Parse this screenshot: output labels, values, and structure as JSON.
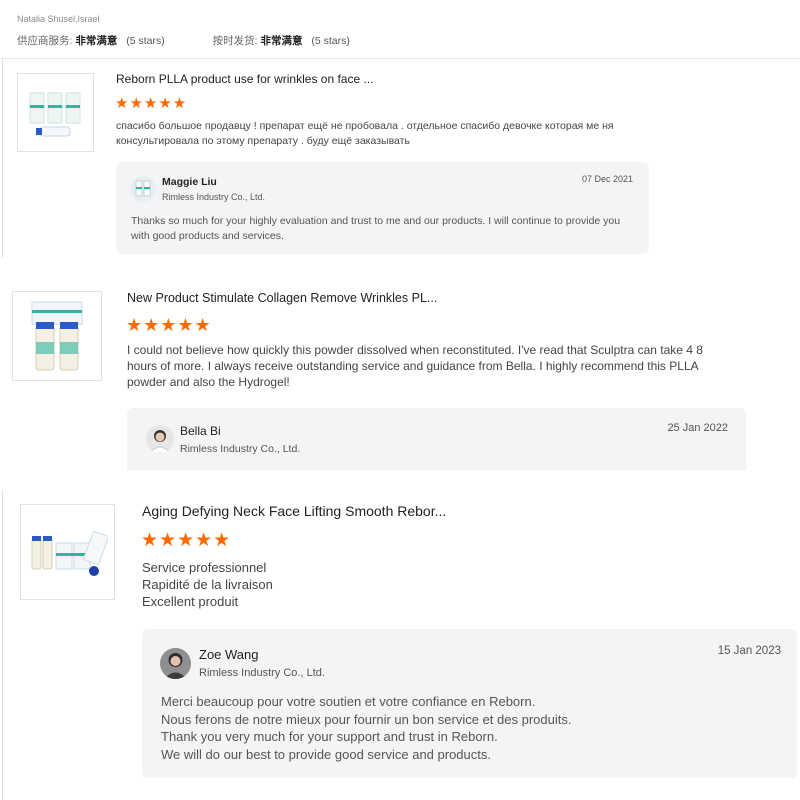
{
  "reviewer": "Natalia Shusel,Israel",
  "ratings": {
    "supplier_label": "供应商服务:",
    "supplier_value": "非常满意",
    "supplier_stars": "(5 stars)",
    "delivery_label": "按时发货:",
    "delivery_value": "非常满意",
    "delivery_stars": "(5 stars)"
  },
  "reviews": [
    {
      "product_title": "Reborn PLLA product use for wrinkles on face ...",
      "stars": "★★★★★",
      "text": "спасибо большое продавцу ! препарат ещё не пробовала . отдельное спасибо девочке которая ме ня консультировала по этому препарату . буду ещё заказывать",
      "reply": {
        "name": "Maggie Liu",
        "company": "Rimless Industry Co., Ltd.",
        "date": "07 Dec 2021",
        "text": "Thanks so much for your highly evaluation and trust to me and  our products. I will continue to provide you with good products and services."
      }
    },
    {
      "product_title": "New Product Stimulate Collagen Remove Wrinkles PL...",
      "stars": "★★★★★",
      "text": "I could not believe how quickly this powder dissolved when reconstituted. I've read that Sculptra can take 4 8 hours of more. I always receive outstanding service and guidance from Bella. I highly recommend this PLLA powder and also the Hydrogel!",
      "reply": {
        "name": "Bella Bi",
        "company": "Rimless Industry Co., Ltd.",
        "date": "25 Jan 2022",
        "text": ""
      }
    },
    {
      "product_title": "Aging Defying Neck Face Lifting Smooth Rebor...",
      "stars": "★★★★★",
      "text": "Service professionnel\nRapidité de la livraison\nExcellent produit",
      "reply": {
        "name": "Zoe Wang",
        "company": "Rimless Industry Co., Ltd.",
        "date": "15 Jan 2023",
        "text": "Merci beaucoup pour votre soutien et votre confiance en Reborn.\nNous ferons de notre mieux pour fournir un bon service et des produits.\nThank you very much for your support and trust in Reborn.\nWe will do our best to provide good service and products."
      }
    }
  ],
  "colors": {
    "star": "#ff6a00",
    "reply_bg": "#f3f4f6",
    "product_accent": "#2fb5a0"
  }
}
